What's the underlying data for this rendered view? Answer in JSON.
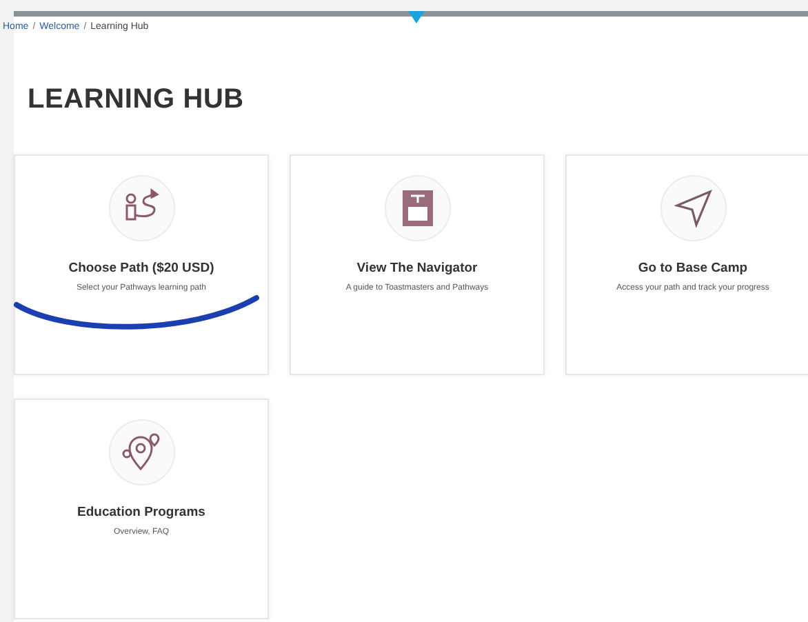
{
  "breadcrumb": [
    "Home",
    "Welcome",
    "Learning Hub"
  ],
  "breadcrumb_separator": "/",
  "title": "LEARNING HUB",
  "cards": [
    {
      "kind": "path",
      "title": "Choose Path ($20 USD)",
      "subtitle": "Select your Pathways learning path"
    },
    {
      "kind": "navigator",
      "title": "View The Navigator",
      "subtitle": "A guide to Toastmasters and Pathways"
    },
    {
      "kind": "basecamp",
      "title": "Go to Base Camp",
      "subtitle": "Access your path and track your progress"
    },
    {
      "kind": "education",
      "title": "Education Programs",
      "subtitle": "Overview, FAQ"
    }
  ]
}
